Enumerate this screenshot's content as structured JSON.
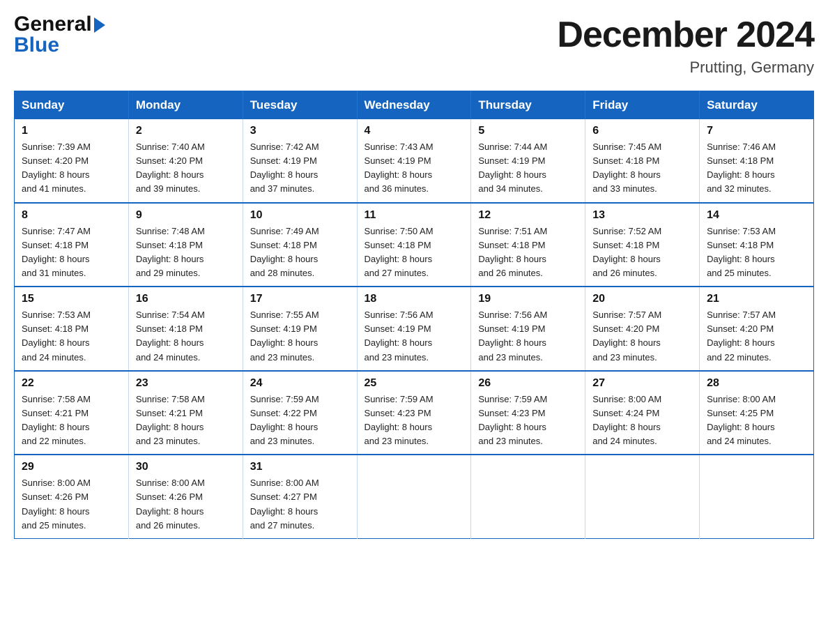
{
  "header": {
    "logo_general": "General",
    "logo_blue": "Blue",
    "month_title": "December 2024",
    "location": "Prutting, Germany"
  },
  "days_of_week": [
    "Sunday",
    "Monday",
    "Tuesday",
    "Wednesday",
    "Thursday",
    "Friday",
    "Saturday"
  ],
  "weeks": [
    [
      {
        "day": "1",
        "sunrise": "7:39 AM",
        "sunset": "4:20 PM",
        "daylight": "8 hours and 41 minutes."
      },
      {
        "day": "2",
        "sunrise": "7:40 AM",
        "sunset": "4:20 PM",
        "daylight": "8 hours and 39 minutes."
      },
      {
        "day": "3",
        "sunrise": "7:42 AM",
        "sunset": "4:19 PM",
        "daylight": "8 hours and 37 minutes."
      },
      {
        "day": "4",
        "sunrise": "7:43 AM",
        "sunset": "4:19 PM",
        "daylight": "8 hours and 36 minutes."
      },
      {
        "day": "5",
        "sunrise": "7:44 AM",
        "sunset": "4:19 PM",
        "daylight": "8 hours and 34 minutes."
      },
      {
        "day": "6",
        "sunrise": "7:45 AM",
        "sunset": "4:18 PM",
        "daylight": "8 hours and 33 minutes."
      },
      {
        "day": "7",
        "sunrise": "7:46 AM",
        "sunset": "4:18 PM",
        "daylight": "8 hours and 32 minutes."
      }
    ],
    [
      {
        "day": "8",
        "sunrise": "7:47 AM",
        "sunset": "4:18 PM",
        "daylight": "8 hours and 31 minutes."
      },
      {
        "day": "9",
        "sunrise": "7:48 AM",
        "sunset": "4:18 PM",
        "daylight": "8 hours and 29 minutes."
      },
      {
        "day": "10",
        "sunrise": "7:49 AM",
        "sunset": "4:18 PM",
        "daylight": "8 hours and 28 minutes."
      },
      {
        "day": "11",
        "sunrise": "7:50 AM",
        "sunset": "4:18 PM",
        "daylight": "8 hours and 27 minutes."
      },
      {
        "day": "12",
        "sunrise": "7:51 AM",
        "sunset": "4:18 PM",
        "daylight": "8 hours and 26 minutes."
      },
      {
        "day": "13",
        "sunrise": "7:52 AM",
        "sunset": "4:18 PM",
        "daylight": "8 hours and 26 minutes."
      },
      {
        "day": "14",
        "sunrise": "7:53 AM",
        "sunset": "4:18 PM",
        "daylight": "8 hours and 25 minutes."
      }
    ],
    [
      {
        "day": "15",
        "sunrise": "7:53 AM",
        "sunset": "4:18 PM",
        "daylight": "8 hours and 24 minutes."
      },
      {
        "day": "16",
        "sunrise": "7:54 AM",
        "sunset": "4:18 PM",
        "daylight": "8 hours and 24 minutes."
      },
      {
        "day": "17",
        "sunrise": "7:55 AM",
        "sunset": "4:19 PM",
        "daylight": "8 hours and 23 minutes."
      },
      {
        "day": "18",
        "sunrise": "7:56 AM",
        "sunset": "4:19 PM",
        "daylight": "8 hours and 23 minutes."
      },
      {
        "day": "19",
        "sunrise": "7:56 AM",
        "sunset": "4:19 PM",
        "daylight": "8 hours and 23 minutes."
      },
      {
        "day": "20",
        "sunrise": "7:57 AM",
        "sunset": "4:20 PM",
        "daylight": "8 hours and 23 minutes."
      },
      {
        "day": "21",
        "sunrise": "7:57 AM",
        "sunset": "4:20 PM",
        "daylight": "8 hours and 22 minutes."
      }
    ],
    [
      {
        "day": "22",
        "sunrise": "7:58 AM",
        "sunset": "4:21 PM",
        "daylight": "8 hours and 22 minutes."
      },
      {
        "day": "23",
        "sunrise": "7:58 AM",
        "sunset": "4:21 PM",
        "daylight": "8 hours and 23 minutes."
      },
      {
        "day": "24",
        "sunrise": "7:59 AM",
        "sunset": "4:22 PM",
        "daylight": "8 hours and 23 minutes."
      },
      {
        "day": "25",
        "sunrise": "7:59 AM",
        "sunset": "4:23 PM",
        "daylight": "8 hours and 23 minutes."
      },
      {
        "day": "26",
        "sunrise": "7:59 AM",
        "sunset": "4:23 PM",
        "daylight": "8 hours and 23 minutes."
      },
      {
        "day": "27",
        "sunrise": "8:00 AM",
        "sunset": "4:24 PM",
        "daylight": "8 hours and 24 minutes."
      },
      {
        "day": "28",
        "sunrise": "8:00 AM",
        "sunset": "4:25 PM",
        "daylight": "8 hours and 24 minutes."
      }
    ],
    [
      {
        "day": "29",
        "sunrise": "8:00 AM",
        "sunset": "4:26 PM",
        "daylight": "8 hours and 25 minutes."
      },
      {
        "day": "30",
        "sunrise": "8:00 AM",
        "sunset": "4:26 PM",
        "daylight": "8 hours and 26 minutes."
      },
      {
        "day": "31",
        "sunrise": "8:00 AM",
        "sunset": "4:27 PM",
        "daylight": "8 hours and 27 minutes."
      },
      null,
      null,
      null,
      null
    ]
  ],
  "labels": {
    "sunrise": "Sunrise:",
    "sunset": "Sunset:",
    "daylight": "Daylight:"
  }
}
